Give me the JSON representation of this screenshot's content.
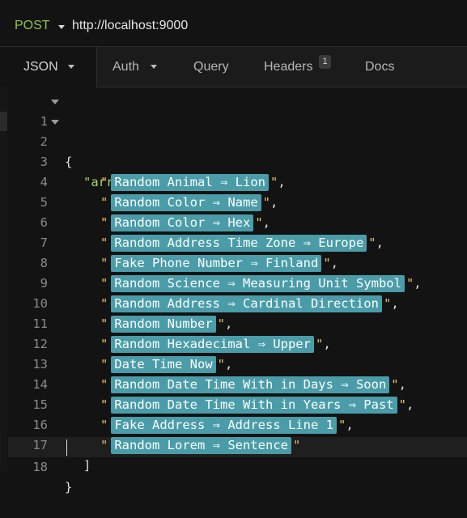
{
  "request": {
    "method": "POST",
    "url": "http://localhost:9000"
  },
  "tabs": {
    "json": "JSON",
    "auth": "Auth",
    "query": "Query",
    "headers": "Headers",
    "headers_count": "1",
    "docs": "Docs"
  },
  "editor": {
    "open_brace": "{",
    "array_key": "\"array\"",
    "colon_bracket": ": [",
    "close_bracket": "]",
    "close_brace": "}",
    "line_numbers": [
      "1",
      "2",
      "3",
      "4",
      "5",
      "6",
      "7",
      "8",
      "9",
      "10",
      "11",
      "12",
      "13",
      "14",
      "15",
      "16",
      "17",
      "18"
    ],
    "items": [
      "Random Animal ⇒ Lion",
      "Random Color ⇒ Name",
      "Random Color ⇒ Hex",
      "Random Address Time Zone ⇒ Europe",
      "Fake Phone Number ⇒ Finland",
      "Random Science ⇒ Measuring Unit Symbol",
      "Random Address ⇒ Cardinal Direction",
      "Random Number",
      "Random Hexadecimal ⇒ Upper",
      "Date Time Now",
      "Random Date Time With in Days ⇒ Soon",
      "Random Date Time With in Years ⇒ Past",
      "Fake Address ⇒ Address Line 1",
      "Random Lorem ⇒ Sentence"
    ]
  },
  "colors": {
    "method": "#8bc34a",
    "key": "#a9d65b",
    "quote": "#e7c26a",
    "tag_bg": "#4a9ca8",
    "background": "#131313"
  }
}
